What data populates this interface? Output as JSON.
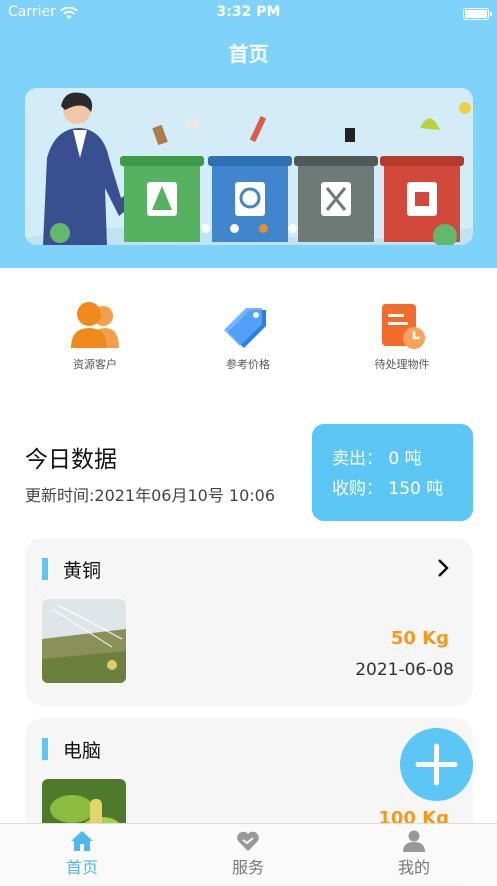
{
  "status_bar": {
    "carrier": "Carrier",
    "time": "3:32 PM"
  },
  "header": {
    "title": "首页"
  },
  "banner": {
    "slide_count": 4,
    "active_index": 2
  },
  "quick_actions": [
    {
      "label": "资源客户",
      "icon": "customers-icon"
    },
    {
      "label": "参考价格",
      "icon": "price-tag-icon"
    },
    {
      "label": "待处理物件",
      "icon": "pending-items-icon"
    }
  ],
  "today": {
    "title": "今日数据",
    "update_time": "更新时间:2021年06月10号 10:06",
    "sold": "卖出：  0 吨",
    "bought": "收购：  150 吨"
  },
  "items": [
    {
      "name": "黄铜",
      "weight": "50 Kg",
      "date": "2021-06-08"
    },
    {
      "name": "电脑",
      "weight": "100 Kg",
      "date": ""
    }
  ],
  "tabbar": [
    {
      "label": "首页",
      "icon": "home-icon",
      "active": true
    },
    {
      "label": "服务",
      "icon": "heart-icon",
      "active": false
    },
    {
      "label": "我的",
      "icon": "person-icon",
      "active": false
    }
  ],
  "colors": {
    "header": "#7fd2fa",
    "accent": "#5cc6f5",
    "weight": "#f39a1a"
  }
}
